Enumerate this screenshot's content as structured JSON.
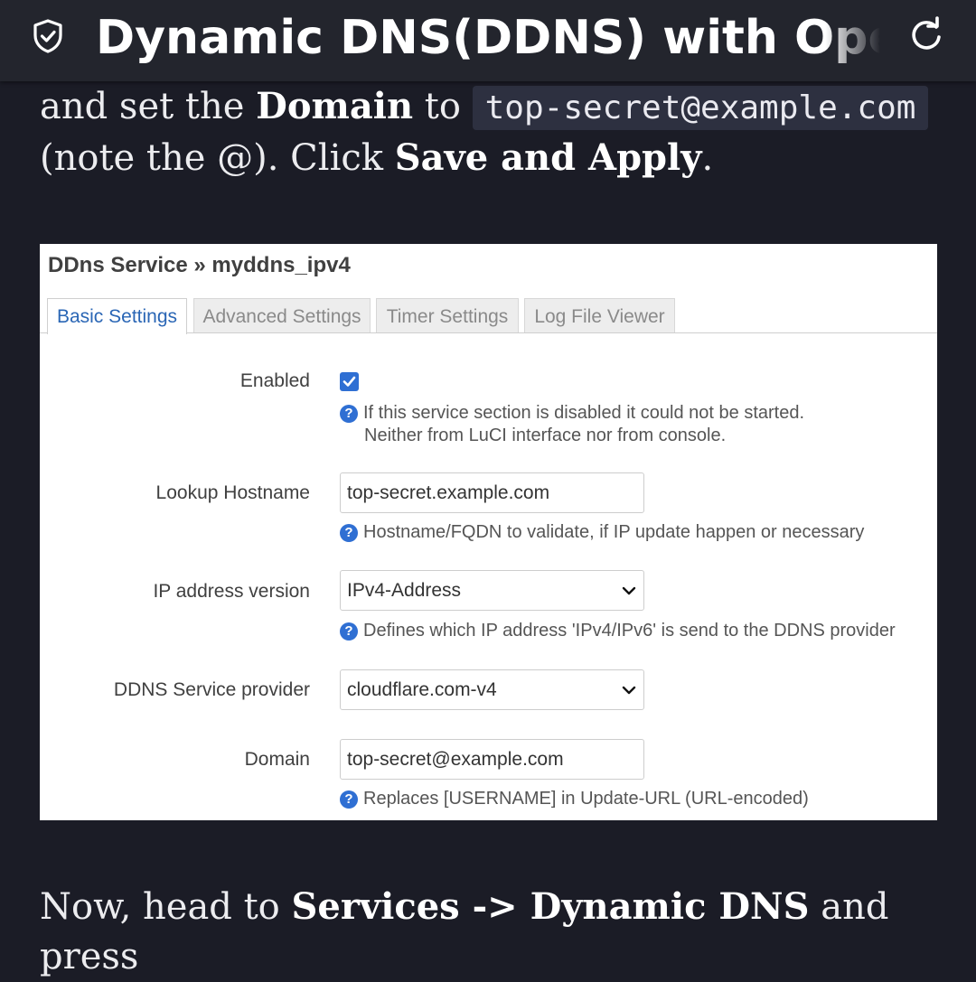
{
  "topbar": {
    "title": "Dynamic DNS(DDNS) with OpenWRT",
    "left_icon": "shield-check-icon",
    "right_icon": "reload-icon"
  },
  "article": {
    "p1": {
      "t1": "and set the ",
      "b1": "Domain",
      "t2": " to ",
      "code": "top-secret@example.com",
      "t3": "(note the @). Click ",
      "b2": "Save and Apply",
      "t4": "."
    },
    "p2": {
      "t1": "Now, head to ",
      "b1": "Services -> Dynamic DNS",
      "t2": " and press"
    }
  },
  "screenshot": {
    "heading": "DDns Service » myddns_ipv4",
    "tabs": [
      "Basic Settings",
      "Advanced Settings",
      "Timer Settings",
      "Log File Viewer"
    ],
    "active_tab": "Basic Settings",
    "enabled": {
      "label": "Enabled",
      "checked": true,
      "help_line1": "If this service section is disabled it could not be started.",
      "help_line2": "Neither from LuCI interface nor from console."
    },
    "lookup_hostname": {
      "label": "Lookup Hostname",
      "value": "top-secret.example.com",
      "help": "Hostname/FQDN to validate, if IP update happen or necessary"
    },
    "ip_version": {
      "label": "IP address version",
      "value": "IPv4-Address",
      "help": "Defines which IP address 'IPv4/IPv6' is send to the DDNS provider"
    },
    "service_provider": {
      "label": "DDNS Service provider",
      "value": "cloudflare.com-v4"
    },
    "domain": {
      "label": "Domain",
      "value": "top-secret@example.com",
      "help": "Replaces [USERNAME] in Update-URL (URL-encoded)"
    },
    "help_icon_text": "?"
  },
  "colors": {
    "page_bg": "#1b1c26",
    "topbar_bg": "#23252d",
    "accent_blue": "#2f6fd3",
    "active_tab_text": "#2a66b5"
  }
}
